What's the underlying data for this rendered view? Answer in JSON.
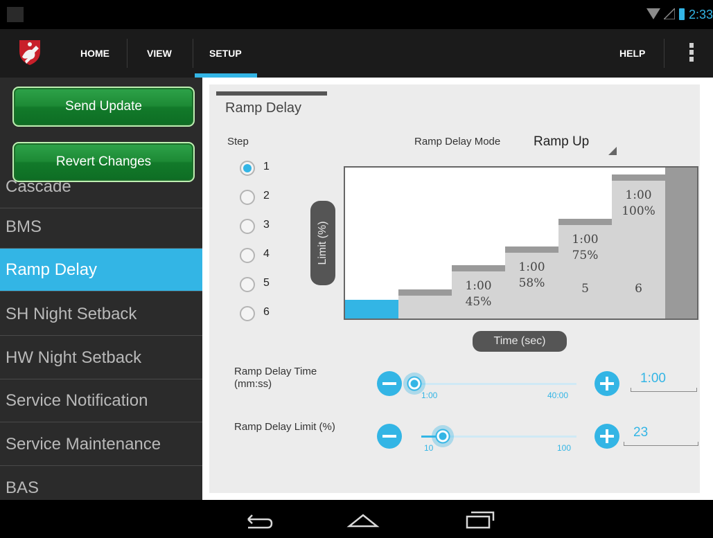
{
  "status_bar": {
    "time": "2:33"
  },
  "action_bar": {
    "nav": [
      "HOME",
      "VIEW",
      "SETUP"
    ],
    "help": "HELP"
  },
  "sidebar": {
    "send_update": "Send Update",
    "revert_changes": "Revert Changes",
    "items": [
      {
        "label": "Cascade",
        "active": false
      },
      {
        "label": "BMS",
        "active": false
      },
      {
        "label": "Ramp Delay",
        "active": true
      },
      {
        "label": "SH Night Setback",
        "active": false
      },
      {
        "label": "HW Night Setback",
        "active": false
      },
      {
        "label": "Service Notification",
        "active": false
      },
      {
        "label": "Service Maintenance",
        "active": false
      },
      {
        "label": "BAS",
        "active": false
      }
    ]
  },
  "main": {
    "title": "Ramp Delay",
    "step_label": "Step",
    "mode_label": "Ramp Delay Mode",
    "mode_value": "Ramp Up",
    "steps": [
      "1",
      "2",
      "3",
      "4",
      "5",
      "6"
    ],
    "selected_step": "1",
    "y_axis_label": "Limit (%)",
    "x_axis_label": "Time (sec)",
    "chart_steps": [
      {
        "step": 1,
        "time": "",
        "limit": "",
        "level": 0.13,
        "selected": true
      },
      {
        "step": 2,
        "time": "",
        "limit": "",
        "level": 0.2,
        "selected": false
      },
      {
        "step": 3,
        "time": "1:00",
        "limit": "45%",
        "level": 0.37,
        "selected": false
      },
      {
        "step": 4,
        "time": "1:00",
        "limit": "58%",
        "level": 0.5,
        "selected": false
      },
      {
        "step": 5,
        "time": "1:00",
        "limit": "75%",
        "level": 0.69,
        "selected": false,
        "number": "5"
      },
      {
        "step": 6,
        "time": "1:00",
        "limit": "100%",
        "level": 1.0,
        "selected": false,
        "number": "6"
      }
    ],
    "time_row": {
      "label": "Ramp Delay Time\n(mm:ss)",
      "min_label": "1:00",
      "max_label": "40:00",
      "value": "1:00",
      "position": 0.0
    },
    "limit_row": {
      "label": "Ramp Delay Limit (%)",
      "min_label": "10",
      "max_label": "100",
      "value": "23",
      "position": 0.14
    }
  },
  "colors": {
    "accent": "#33b5e5",
    "button_green": "#1d8a35",
    "sidebar_bg": "#2b2b2b",
    "bar_fill": "#d4d4d4",
    "bar_cap": "#9a9a9a"
  }
}
